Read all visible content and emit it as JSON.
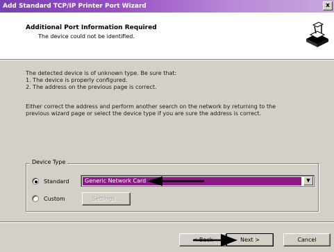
{
  "window": {
    "title": "Add Standard TCP/IP Printer Port Wizard",
    "close_glyph": "x"
  },
  "header": {
    "title": "Additional Port Information Required",
    "subtitle": "The device could not be identified.",
    "icon": "printer-wizard-icon"
  },
  "body": {
    "line1": "The detected device is of unknown type.  Be sure that:",
    "line2": "1.  The device is properly configured.",
    "line3": "2.  The address on the previous page is correct.",
    "line4": "Either correct the address and perform another search on the network by returning to the",
    "line5": "previous wizard page or select the device type if you are sure the address is correct."
  },
  "device_type": {
    "group_label": "Device Type",
    "standard_label": "Standard",
    "custom_label": "Custom",
    "selected": "standard",
    "dropdown_value": "Generic Network Card",
    "settings_label": "Settings..."
  },
  "buttons": {
    "back": "< Back",
    "next": "Next >",
    "cancel": "Cancel"
  },
  "colors": {
    "title_bar": "#7a3fb4",
    "selection": "#8b1a87",
    "dialog_face": "#d4d0c8"
  }
}
